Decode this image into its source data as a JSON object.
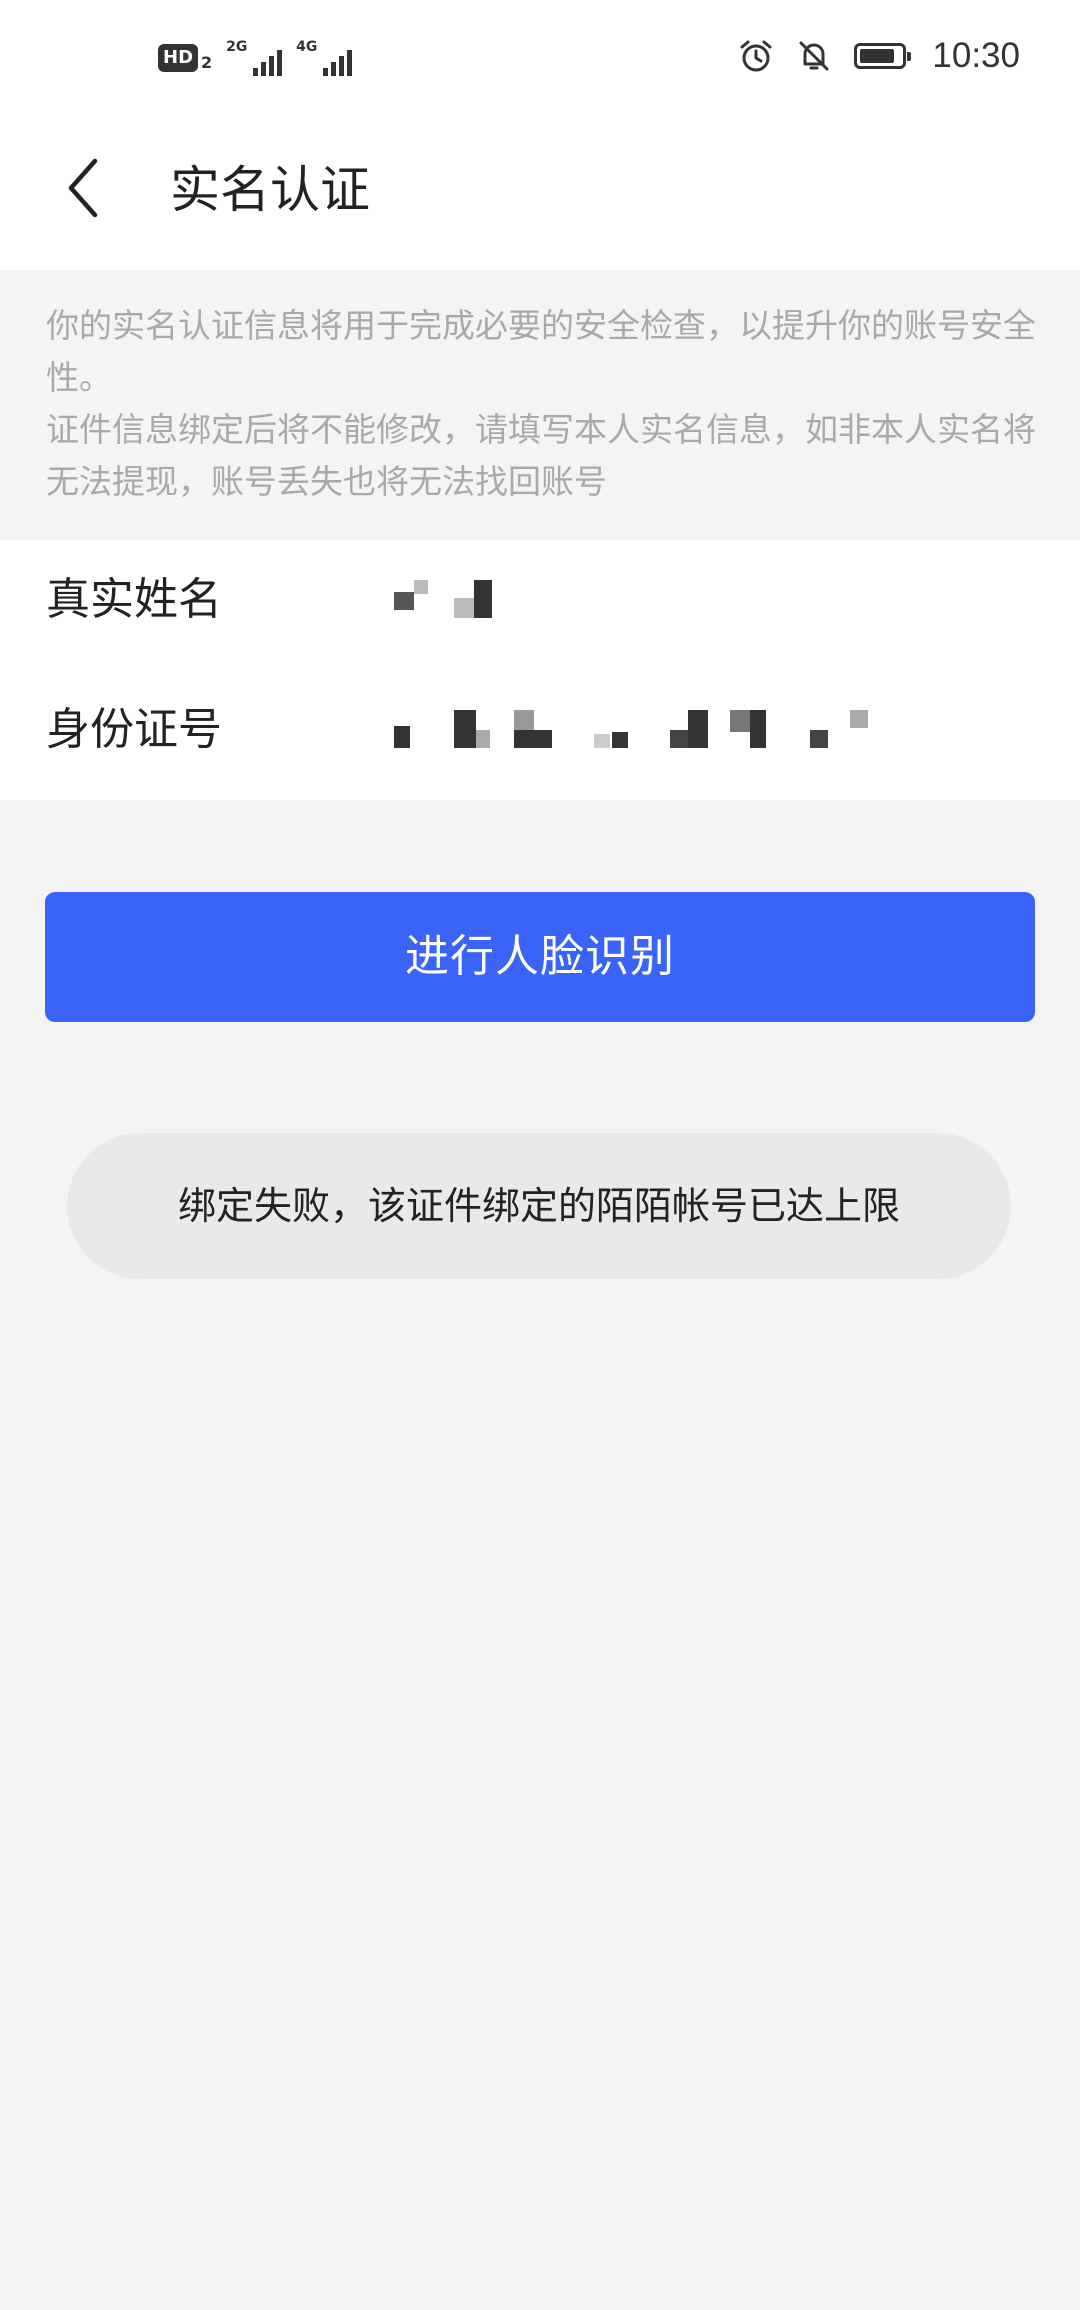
{
  "status_bar": {
    "hd_label": "HD",
    "hd_sub": "2",
    "network_1": "2G",
    "network_2": "4G",
    "time": "10:30",
    "icons": [
      "alarm-icon",
      "bell-off-icon",
      "battery-icon"
    ],
    "battery_level": 0.8
  },
  "header": {
    "back_icon": "chevron-left-icon",
    "title": "实名认证"
  },
  "notice": {
    "line1": "你的实名认证信息将用于完成必要的安全检查，以提升你的账号安全性。",
    "line2": "证件信息绑定后将不能修改，请填写本人实名信息，如非本人实名将无法提现，账号丢失也将无法找回账号"
  },
  "form": {
    "name_label": "真实姓名",
    "id_label": "身份证号"
  },
  "actions": {
    "face_recognition_label": "进行人脸识别"
  },
  "toast": {
    "message": "绑定失败，该证件绑定的陌陌帐号已达上限"
  },
  "colors": {
    "primary": "#3a63fa",
    "background": "#f4f4f5",
    "notice_text": "#a9a9ad",
    "toast_bg": "#e9e9eb"
  }
}
